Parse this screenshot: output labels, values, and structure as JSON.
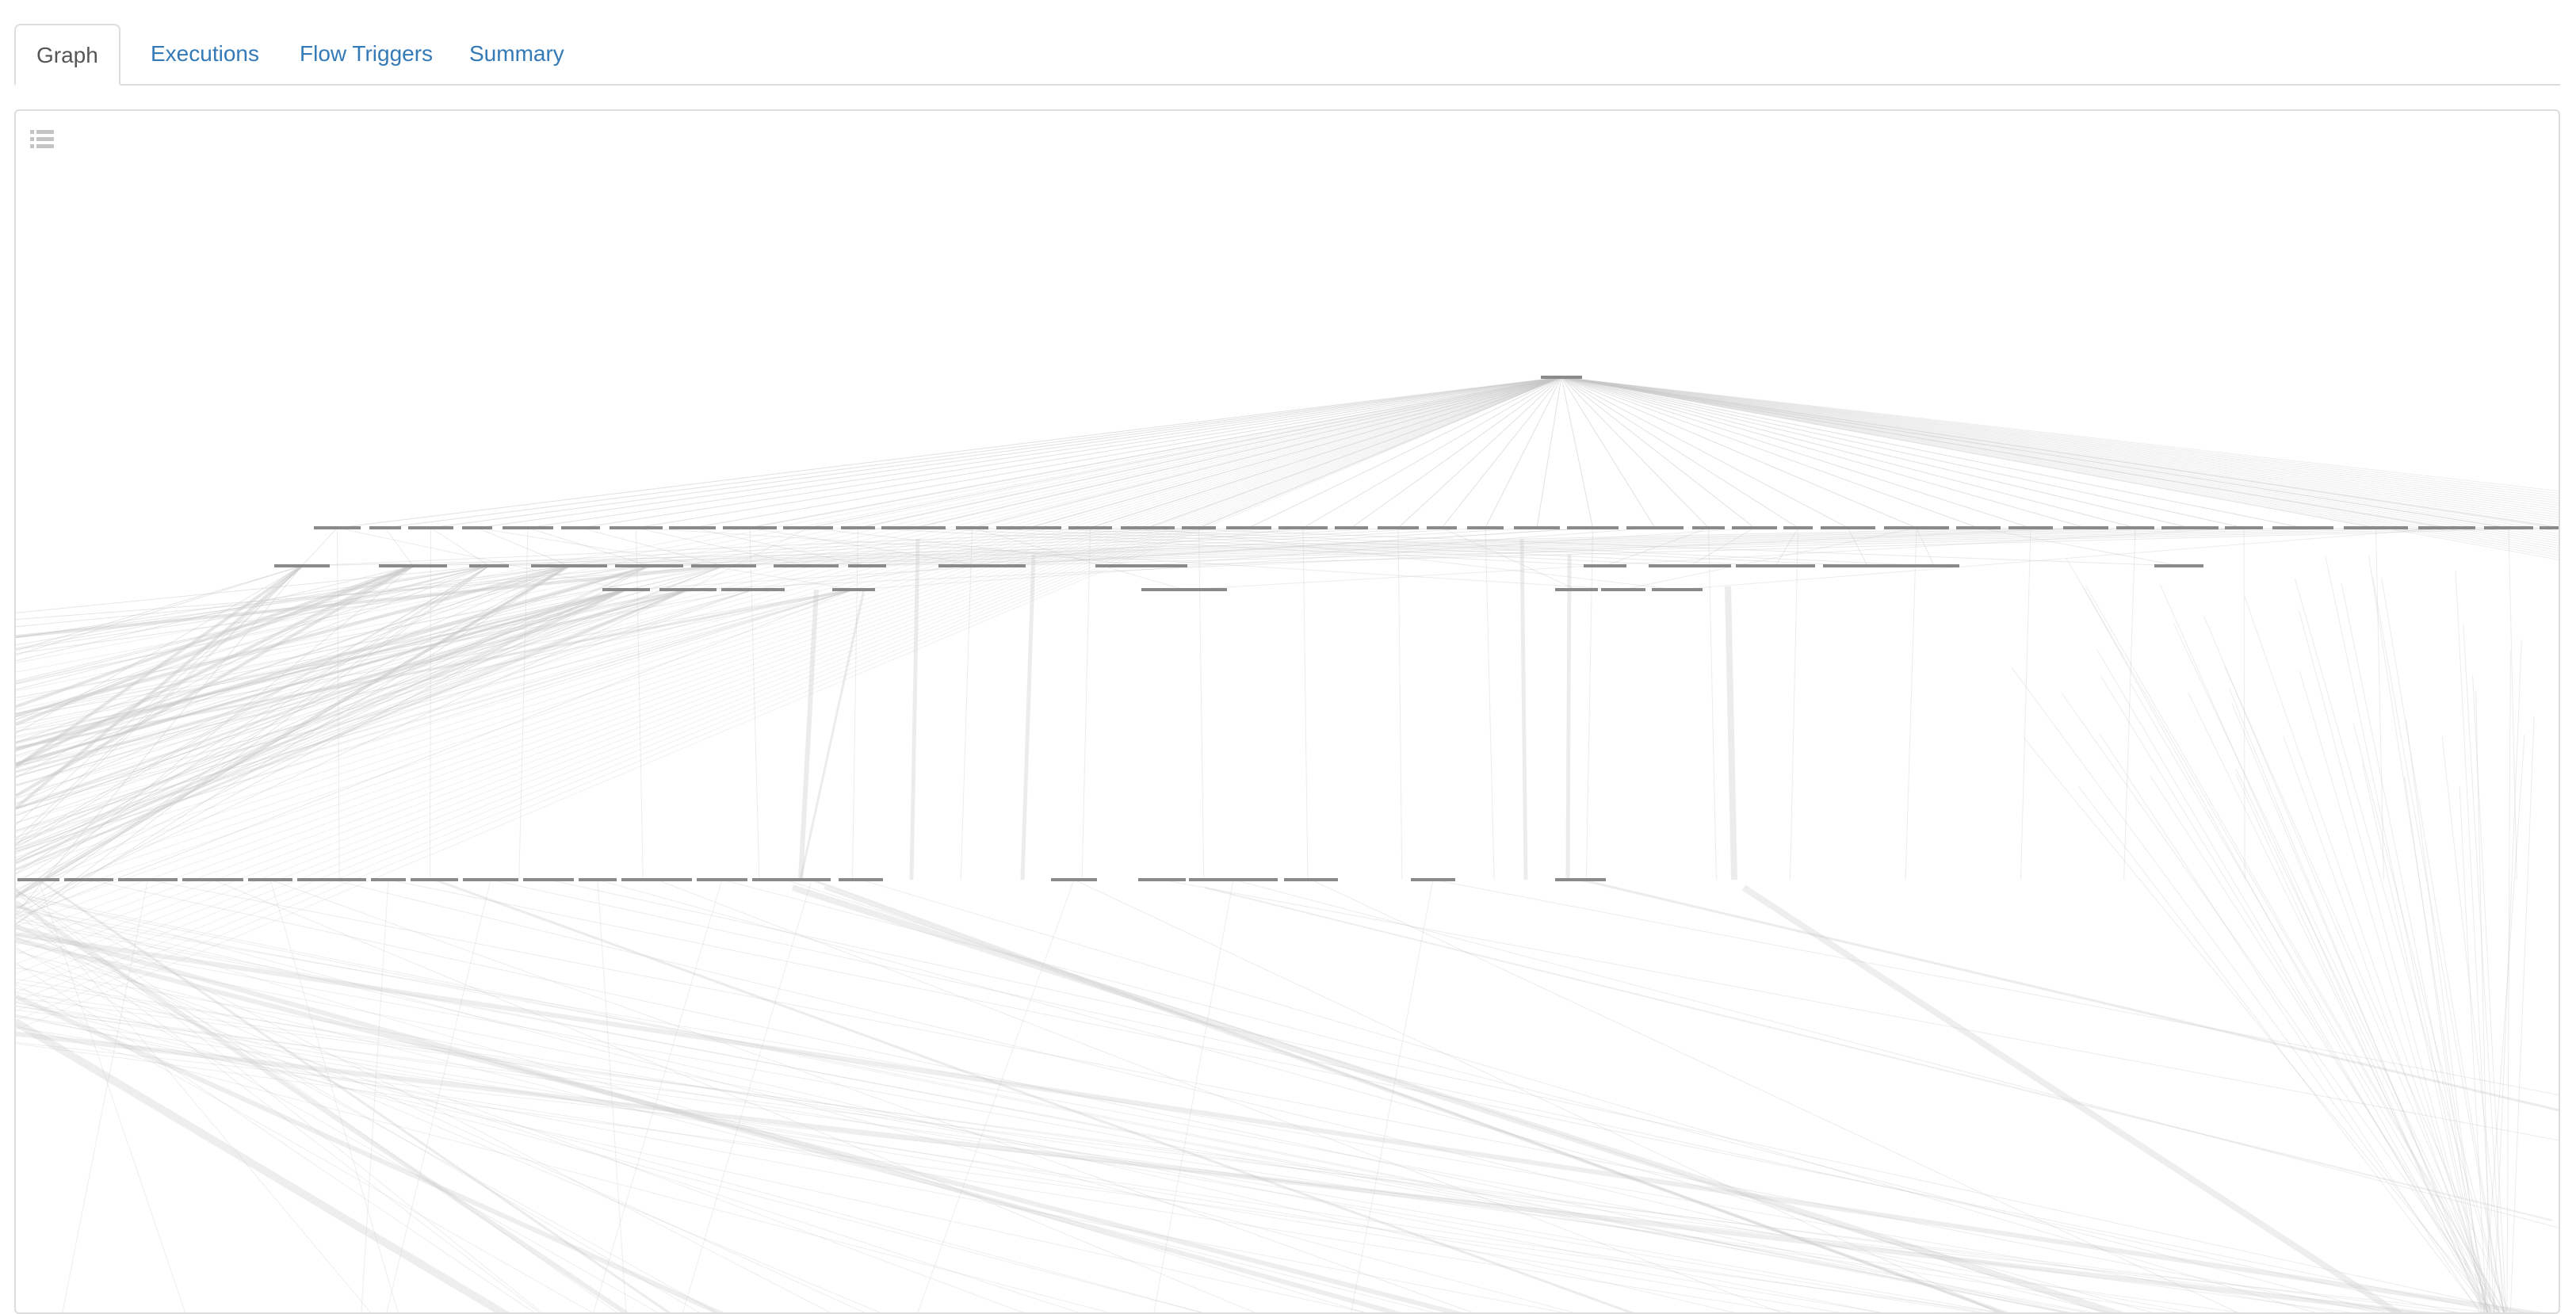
{
  "tabs": [
    {
      "label": "Graph",
      "active": true
    },
    {
      "label": "Executions",
      "active": false
    },
    {
      "label": "Flow Triggers",
      "active": false
    },
    {
      "label": "Summary",
      "active": false
    }
  ],
  "graph": {
    "toolbar_icon": "list-icon",
    "edge_color": "#c8c8c8",
    "node_color": "#8a8a8a",
    "accent_color": "#337ab7"
  }
}
